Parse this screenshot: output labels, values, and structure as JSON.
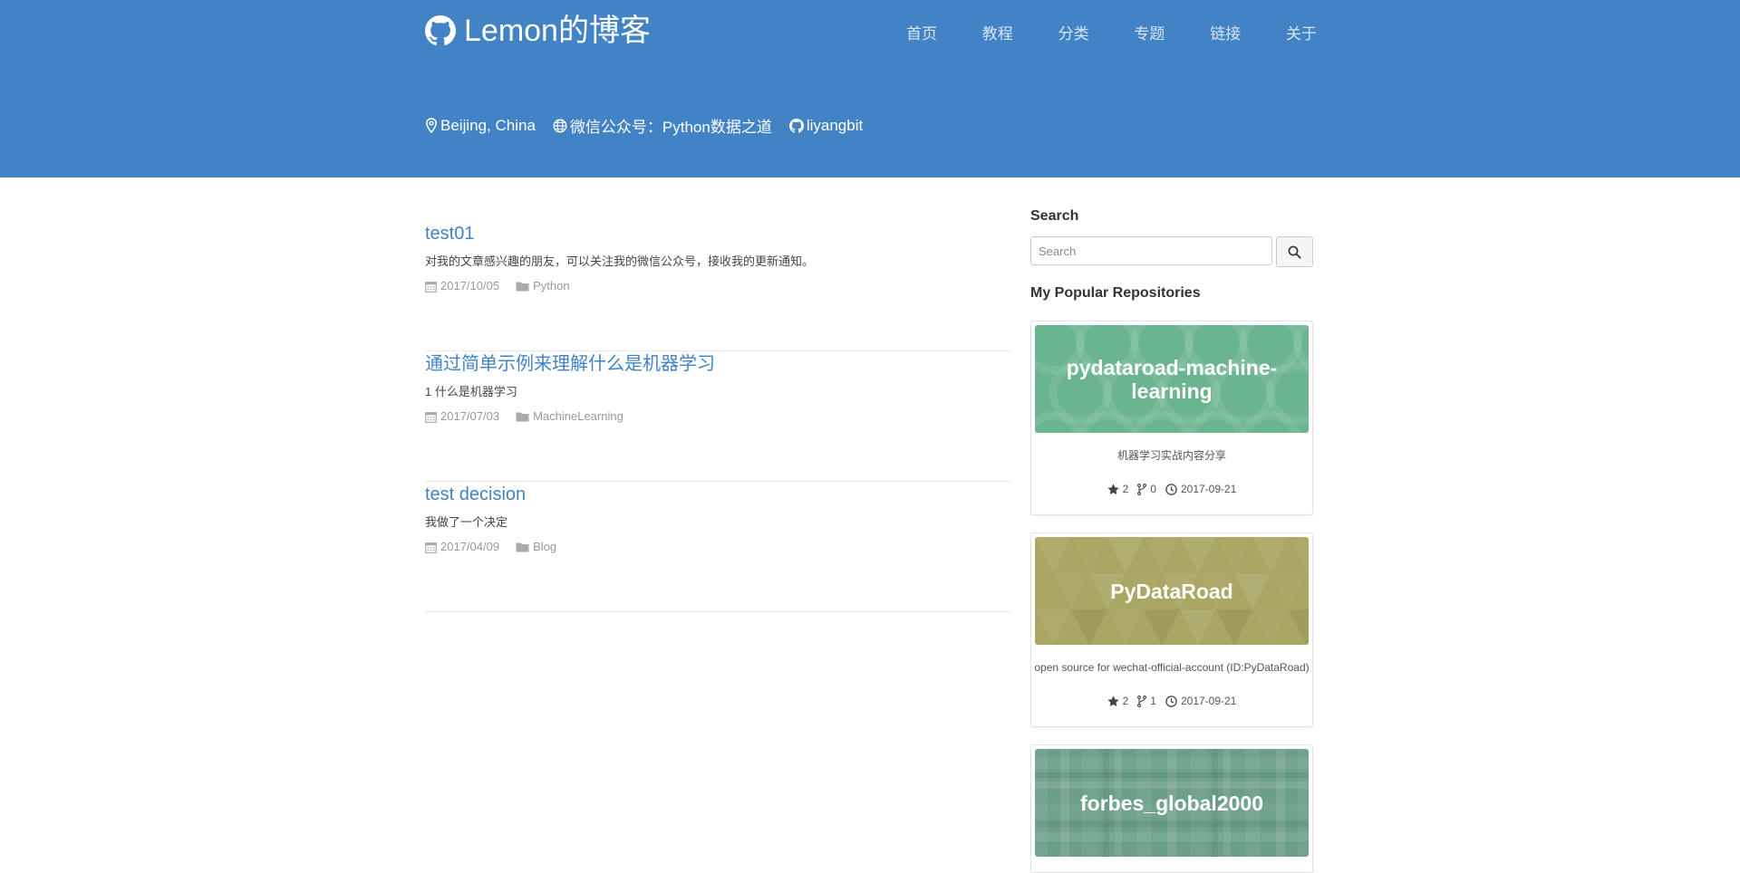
{
  "site": {
    "title": "Lemon的博客"
  },
  "nav": [
    {
      "label": "首页"
    },
    {
      "label": "教程"
    },
    {
      "label": "分类"
    },
    {
      "label": "专题"
    },
    {
      "label": "链接"
    },
    {
      "label": "关于"
    }
  ],
  "info": {
    "location": "Beijing, China",
    "wechat": "微信公众号：Python数据之道",
    "github": "liyangbit"
  },
  "posts": [
    {
      "title": "test01",
      "excerpt": "对我的文章感兴趣的朋友，可以关注我的微信公众号，接收我的更新通知。",
      "date": "2017/10/05",
      "category": "Python"
    },
    {
      "title": "通过简单示例来理解什么是机器学习",
      "excerpt": "1 什么是机器学习",
      "date": "2017/07/03",
      "category": "MachineLearning"
    },
    {
      "title": "test decision",
      "excerpt": "我做了一个决定",
      "date": "2017/04/09",
      "category": "Blog"
    }
  ],
  "sidebar": {
    "search_heading": "Search",
    "search_placeholder": "Search",
    "repos_heading": "My Popular Repositories",
    "repos": [
      {
        "name": "pydataroad-machine-learning",
        "description": "机器学习实战内容分享",
        "stars": "2",
        "forks": "0",
        "updated": "2017-09-21",
        "color": "#6ab590"
      },
      {
        "name": "PyDataRoad",
        "description": "open source for wechat-official-account (ID:PyDataRoad)",
        "stars": "2",
        "forks": "1",
        "updated": "2017-09-21",
        "color": "#a9a562"
      },
      {
        "name": "forbes_global2000",
        "description": "",
        "stars": "",
        "forks": "",
        "updated": "",
        "color": "#6b9f88"
      }
    ]
  },
  "colors": {
    "header": "#4183c4",
    "link": "#4183c4"
  },
  "icons": {
    "brand": "github-icon",
    "location": "map-marker-icon",
    "wechat": "globe-icon",
    "github": "github-icon",
    "date": "calendar-icon",
    "category": "folder-icon",
    "search": "search-icon",
    "stars": "star-icon",
    "forks": "fork-icon",
    "updated": "clock-icon"
  }
}
